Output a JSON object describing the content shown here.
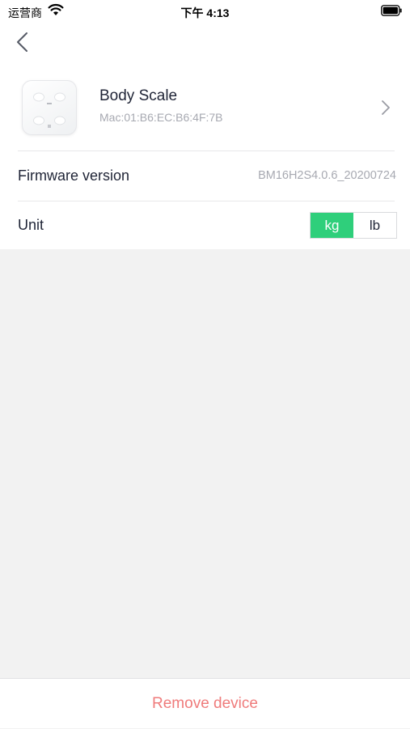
{
  "status_bar": {
    "carrier": "运营商",
    "time": "下午 4:13",
    "wifi_icon": "wifi-icon",
    "battery_icon": "battery-icon"
  },
  "nav": {
    "back_icon": "chevron-left-icon"
  },
  "device": {
    "name": "Body Scale",
    "mac": "Mac:01:B6:EC:B6:4F:7B",
    "thumbnail_icon": "body-scale-icon",
    "chevron_icon": "chevron-right-icon"
  },
  "firmware": {
    "label": "Firmware version",
    "value": "BM16H2S4.0.6_20200724"
  },
  "unit": {
    "label": "Unit",
    "options": [
      "kg",
      "lb"
    ],
    "selected": "kg"
  },
  "footer": {
    "remove_label": "Remove device"
  },
  "colors": {
    "accent_green": "#2fcf7b",
    "danger_text": "#ef7b7b",
    "page_background": "#f2f2f2"
  }
}
